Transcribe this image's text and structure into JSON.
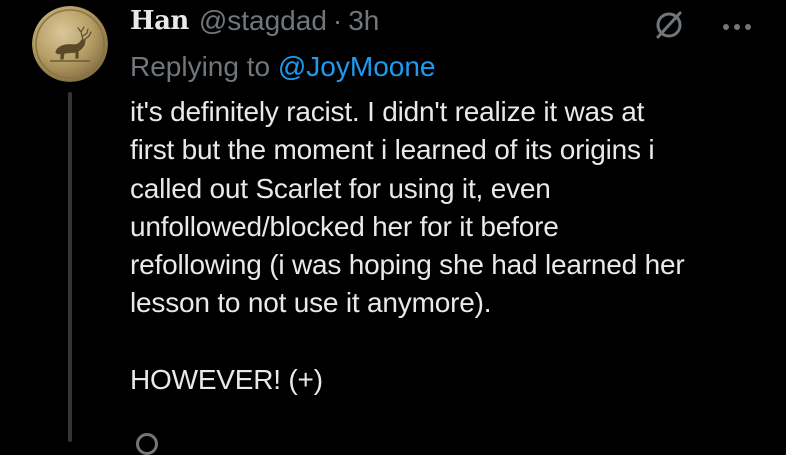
{
  "tweet": {
    "display_name": "ℌnn",
    "display_name_text": "Han",
    "handle": "@stagdad",
    "separator": "·",
    "time": "3h",
    "replying_prefix": "Replying to ",
    "replying_to": "@JoyMoone",
    "body": "it's definitely racist. I didn't realize it was at\nfirst but the moment i learned of its origins i\ncalled out Scarlet for using it, even\nunfollowed/blocked her for it before\nrefollowing (i was hoping she had learned her\nlesson to not use it anymore).\n\nHOWEVER! (+)"
  },
  "icons": {
    "avatar": "stag-coin-avatar",
    "hidden": "circle-slash-icon",
    "more": "more-dots-icon"
  },
  "colors": {
    "background": "#000000",
    "text": "#e7e9ea",
    "secondary": "#71767b",
    "accent": "#1d9bf0"
  }
}
